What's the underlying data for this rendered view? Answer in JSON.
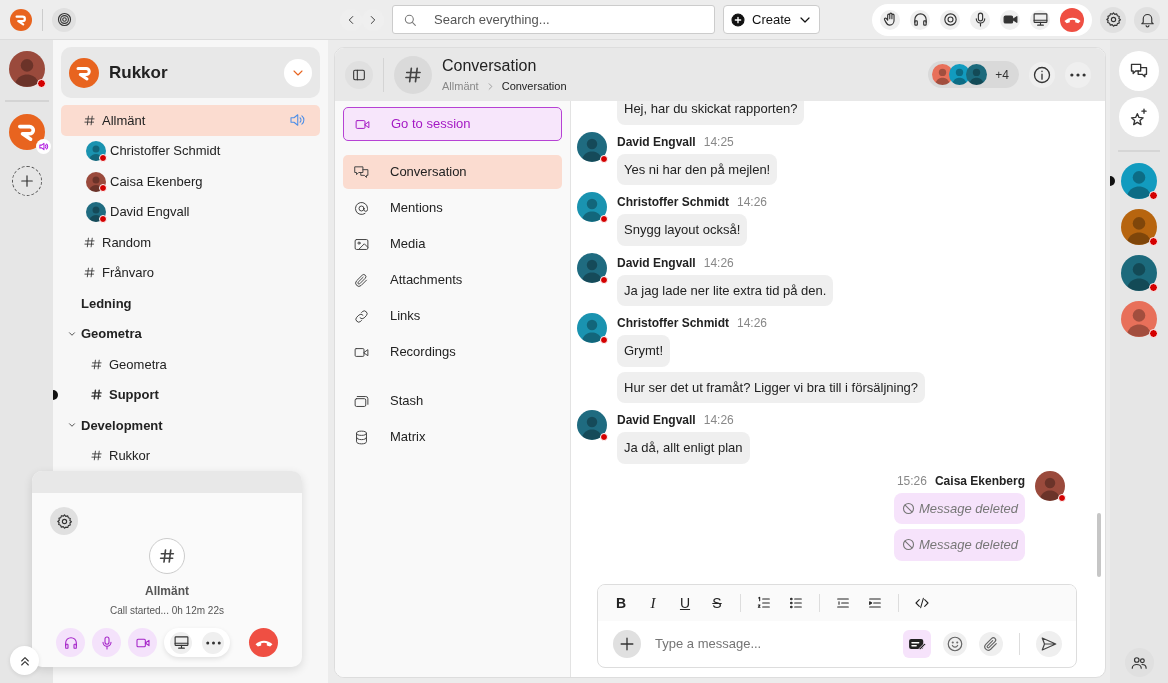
{
  "top_bar": {
    "search_placeholder": "Search everything...",
    "create_label": "Create"
  },
  "rail": {
    "user": {
      "color": "#9a4a3c",
      "busy": true
    },
    "workspace": {
      "in_call": true
    }
  },
  "sidebar": {
    "title": "Rukkor",
    "items": [
      {
        "kind": "channel",
        "name": "Allmänt",
        "selected": true,
        "unread": false,
        "audio": true,
        "children": [
          {
            "kind": "member",
            "name": "Christoffer Schmidt",
            "color": "#1a93b0",
            "busy": true
          },
          {
            "kind": "member",
            "name": "Caisa Ekenberg",
            "color": "#9a4a3c",
            "busy": true
          },
          {
            "kind": "member",
            "name": "David Engvall",
            "color": "#1f6b80",
            "busy": true
          }
        ]
      },
      {
        "kind": "channel",
        "name": "Random",
        "selected": false,
        "unread": false
      },
      {
        "kind": "channel",
        "name": "Frånvaro",
        "selected": false,
        "unread": false
      },
      {
        "kind": "group",
        "name": "Ledning"
      },
      {
        "kind": "group",
        "name": "Geometra",
        "expanded": true,
        "children": [
          {
            "kind": "channel",
            "name": "Geometra",
            "selected": false,
            "unread": false
          },
          {
            "kind": "channel",
            "name": "Support",
            "selected": false,
            "unread": true
          }
        ]
      },
      {
        "kind": "group",
        "name": "Development",
        "expanded": true,
        "children": [
          {
            "kind": "channel",
            "name": "Rukkor",
            "selected": false,
            "unread": false
          }
        ]
      }
    ]
  },
  "call": {
    "channel": "Allmänt",
    "status": "Call started... 0h 12m 22s",
    "controls": [
      {
        "kind": "headphones",
        "active": true
      },
      {
        "kind": "mic",
        "active": true
      },
      {
        "kind": "camera",
        "active": true
      }
    ]
  },
  "header": {
    "title": "Conversation",
    "breadcrumb": [
      "Allmänt",
      "Conversation"
    ],
    "participants": [
      {
        "color": "#e8705a"
      },
      {
        "color": "#129bbf"
      },
      {
        "color": "#1c6a7c"
      }
    ],
    "more": "+4"
  },
  "nav": {
    "session": "Go to session",
    "items": [
      {
        "kind": "conversation",
        "label": "Conversation",
        "selected": true
      },
      {
        "kind": "mentions",
        "label": "Mentions",
        "selected": false
      },
      {
        "kind": "media",
        "label": "Media",
        "selected": false
      },
      {
        "kind": "attachments",
        "label": "Attachments",
        "selected": false
      },
      {
        "kind": "links",
        "label": "Links",
        "selected": false
      },
      {
        "kind": "recordings",
        "label": "Recordings",
        "selected": false
      }
    ],
    "extra_items": [
      {
        "kind": "stash",
        "label": "Stash",
        "selected": false
      },
      {
        "kind": "matrix",
        "label": "Matrix",
        "selected": false
      }
    ]
  },
  "messages": [
    {
      "mine": false,
      "bubbles": [
        {
          "text": "Hej, har du skickat rapporten?"
        }
      ]
    },
    {
      "author": "David Engvall",
      "time": "14:25",
      "color": "#1f6b80",
      "busy": true,
      "mine": false,
      "bubbles": [
        {
          "text": "Yes ni har den på mejlen!"
        }
      ]
    },
    {
      "author": "Christoffer Schmidt",
      "time": "14:26",
      "color": "#1a93b0",
      "busy": true,
      "mine": false,
      "bubbles": [
        {
          "text": "Snygg layout också!"
        }
      ]
    },
    {
      "author": "David Engvall",
      "time": "14:26",
      "color": "#1f6b80",
      "busy": true,
      "mine": false,
      "bubbles": [
        {
          "text": "Ja jag lade ner lite extra tid på den."
        }
      ]
    },
    {
      "author": "Christoffer Schmidt",
      "time": "14:26",
      "color": "#1a93b0",
      "busy": true,
      "mine": false,
      "bubbles": [
        {
          "text": "Grymt!"
        },
        {
          "text": "Hur ser det ut framåt? Ligger vi bra till i försäljning?"
        }
      ]
    },
    {
      "author": "David Engvall",
      "time": "14:26",
      "color": "#1f6b80",
      "busy": true,
      "mine": false,
      "bubbles": [
        {
          "text": "Ja då, allt enligt plan"
        }
      ]
    },
    {
      "author": "Caisa Ekenberg",
      "time": "15:26",
      "color": "#9a4a3c",
      "busy": true,
      "mine": true,
      "bubbles": [
        {
          "text": "Message deleted",
          "deleted": true
        },
        {
          "text": "Message deleted",
          "deleted": true
        }
      ]
    }
  ],
  "composer": {
    "format": [
      {
        "kind": "bold",
        "label": "B"
      },
      {
        "kind": "italic",
        "label": "I"
      },
      {
        "kind": "underline",
        "label": "U"
      },
      {
        "kind": "strike",
        "label": "S"
      }
    ],
    "placeholder": "Type a message..."
  },
  "members": [
    {
      "color": "#129bbf",
      "busy": true,
      "unread": true
    },
    {
      "color": "#b7650f",
      "busy": true,
      "unread": false
    },
    {
      "color": "#1c6a7c",
      "busy": true,
      "unread": false
    },
    {
      "color": "#e8705a",
      "busy": true,
      "unread": false
    }
  ]
}
